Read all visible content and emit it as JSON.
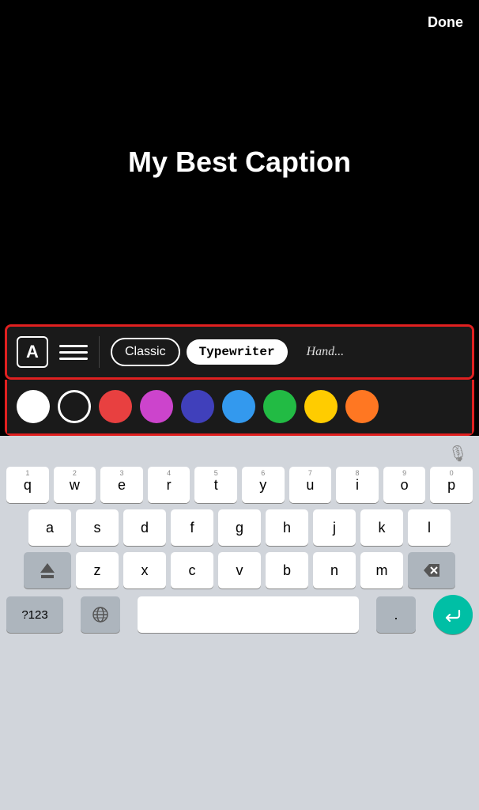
{
  "header": {
    "done_label": "Done"
  },
  "canvas": {
    "caption": "My Best Caption"
  },
  "toolbar": {
    "font_icon_label": "A",
    "font_options": [
      {
        "id": "classic",
        "label": "Classic",
        "active": false
      },
      {
        "id": "typewriter",
        "label": "Typewriter",
        "active": true
      },
      {
        "id": "handwriting",
        "label": "Handwriting",
        "active": false
      }
    ]
  },
  "colors": [
    {
      "id": "white-filled",
      "label": "White filled"
    },
    {
      "id": "white-outline",
      "label": "White outline"
    },
    {
      "id": "red",
      "label": "Red"
    },
    {
      "id": "purple",
      "label": "Purple"
    },
    {
      "id": "dark-blue",
      "label": "Dark blue"
    },
    {
      "id": "blue",
      "label": "Blue"
    },
    {
      "id": "green",
      "label": "Green"
    },
    {
      "id": "yellow",
      "label": "Yellow"
    },
    {
      "id": "orange",
      "label": "Orange"
    }
  ],
  "keyboard": {
    "row1": [
      "q",
      "w",
      "e",
      "r",
      "t",
      "y",
      "u",
      "i",
      "o",
      "p"
    ],
    "row1_nums": [
      "1",
      "2",
      "3",
      "4",
      "5",
      "6",
      "7",
      "8",
      "9",
      "0"
    ],
    "row2": [
      "a",
      "s",
      "d",
      "f",
      "g",
      "h",
      "j",
      "k",
      "l"
    ],
    "row3": [
      "z",
      "x",
      "c",
      "v",
      "b",
      "n",
      "m"
    ],
    "num_key": "?123",
    "space_label": "",
    "period_label": ".",
    "return_icon": "↵"
  },
  "accent": {
    "red_border": "#e02020",
    "return_color": "#00bfa5"
  }
}
